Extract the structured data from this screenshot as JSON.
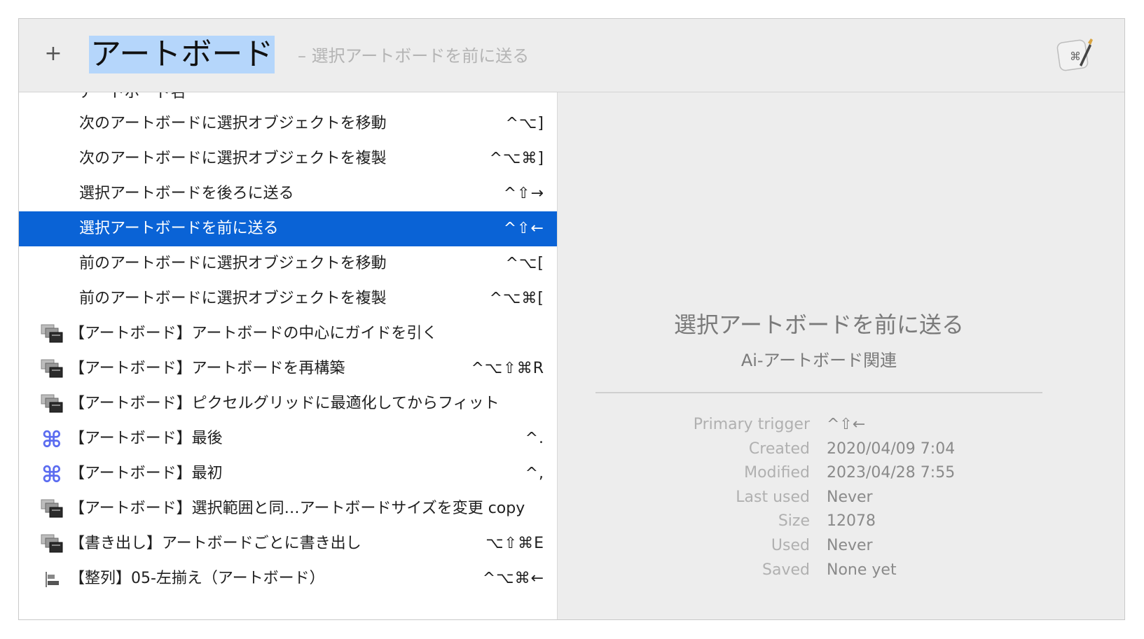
{
  "search": {
    "add_label": "+",
    "query": "アートボード",
    "hint": "– 選択アートボードを前に送る"
  },
  "icons": {
    "app": "keyboard-maestro-app-icon",
    "macro_group": "macro-group-icon",
    "command": "command-key-icon",
    "align": "align-left-icon"
  },
  "colors": {
    "selection": "#0a63d6",
    "command_icon": "#5b6cf0",
    "query_highlight": "#b5d6fb"
  },
  "list": {
    "clipped_top_label": "アートボード名",
    "items": [
      {
        "label": "次のアートボードに選択オブジェクトを移動",
        "shortcut": "^⌥]",
        "icon": "none"
      },
      {
        "label": "次のアートボードに選択オブジェクトを複製",
        "shortcut": "^⌥⌘]",
        "icon": "none"
      },
      {
        "label": "選択アートボードを後ろに送る",
        "shortcut": "^⇧→",
        "icon": "none"
      },
      {
        "label": "選択アートボードを前に送る",
        "shortcut": "^⇧←",
        "icon": "none",
        "selected": true
      },
      {
        "label": "前のアートボードに選択オブジェクトを移動",
        "shortcut": "^⌥[",
        "icon": "none"
      },
      {
        "label": "前のアートボードに選択オブジェクトを複製",
        "shortcut": "^⌥⌘[",
        "icon": "none"
      },
      {
        "label": "【アートボード】アートボードの中心にガイドを引く",
        "shortcut": "",
        "icon": "macro-group-icon"
      },
      {
        "label": "【アートボード】アートボードを再構築",
        "shortcut": "^⌥⇧⌘R",
        "icon": "macro-group-icon"
      },
      {
        "label": "【アートボード】ピクセルグリッドに最適化してからフィット",
        "shortcut": "",
        "icon": "macro-group-icon"
      },
      {
        "label": "【アートボード】最後",
        "shortcut": "^.",
        "icon": "command-key-icon"
      },
      {
        "label": "【アートボード】最初",
        "shortcut": "^,",
        "icon": "command-key-icon"
      },
      {
        "label": "【アートボード】選択範囲と同…アートボードサイズを変更 copy",
        "shortcut": "",
        "icon": "macro-group-icon"
      },
      {
        "label": "【書き出し】アートボードごとに書き出し",
        "shortcut": "⌥⇧⌘E",
        "icon": "macro-group-icon"
      },
      {
        "label": "【整列】05-左揃え（アートボード）",
        "shortcut": "^⌥⌘←",
        "icon": "align-left-icon"
      }
    ]
  },
  "detail": {
    "title": "選択アートボードを前に送る",
    "group": "Ai-アートボード関連",
    "meta": [
      {
        "key": "Primary trigger",
        "value": "^⇧←"
      },
      {
        "key": "Created",
        "value": "2020/04/09 7:04"
      },
      {
        "key": "Modified",
        "value": "2023/04/28 7:55"
      },
      {
        "key": "Last used",
        "value": "Never"
      },
      {
        "key": "Size",
        "value": "12078"
      },
      {
        "key": "Used",
        "value": "Never"
      },
      {
        "key": "Saved",
        "value": "None yet"
      }
    ]
  }
}
